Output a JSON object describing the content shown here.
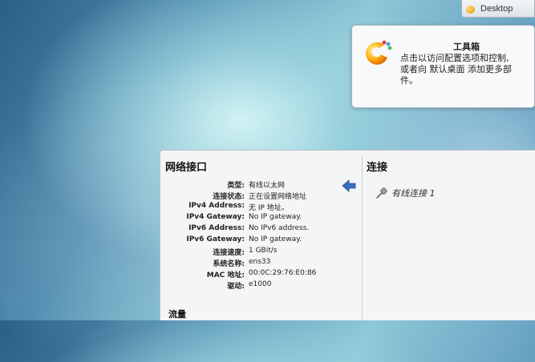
{
  "taskbar": {
    "desktop_label": "Desktop"
  },
  "tooltip": {
    "title": "工具箱",
    "body_lines": [
      "点击以访问配置选项和控制,",
      "或者向 默认桌面 添加更多部",
      "件。"
    ]
  },
  "network_panel": {
    "title": "网络接口",
    "fields": [
      {
        "key": "类型:",
        "value": "有线以太网"
      },
      {
        "key": "连接状态:",
        "value": "正在设置网络地址"
      },
      {
        "key": "IPv4 Address:",
        "value": "无 IP 地址。"
      },
      {
        "key": "IPv4 Gateway:",
        "value": "No IP gateway."
      },
      {
        "key": "IPv6 Address:",
        "value": "No IPv6 address."
      },
      {
        "key": "IPv6 Gateway:",
        "value": "No IP gateway."
      },
      {
        "key": "连接速度:",
        "value": "1 GBit/s"
      },
      {
        "key": "系统名称:",
        "value": "ens33"
      },
      {
        "key": "MAC 地址:",
        "value": "00:0C:29:76:E0:86"
      },
      {
        "key": "驱动:",
        "value": "e1000"
      }
    ],
    "traffic_title": "流量"
  },
  "connections_panel": {
    "title": "连接",
    "items": [
      "有线连接 1"
    ]
  },
  "colors": {
    "arrow": "#3b6fc2",
    "tooltip_bg": "#f8f9fb",
    "dialog_bg": "#f4f5f6"
  },
  "icons": [
    "toolbox-icon",
    "back-arrow-icon",
    "wired-connection-icon"
  ]
}
